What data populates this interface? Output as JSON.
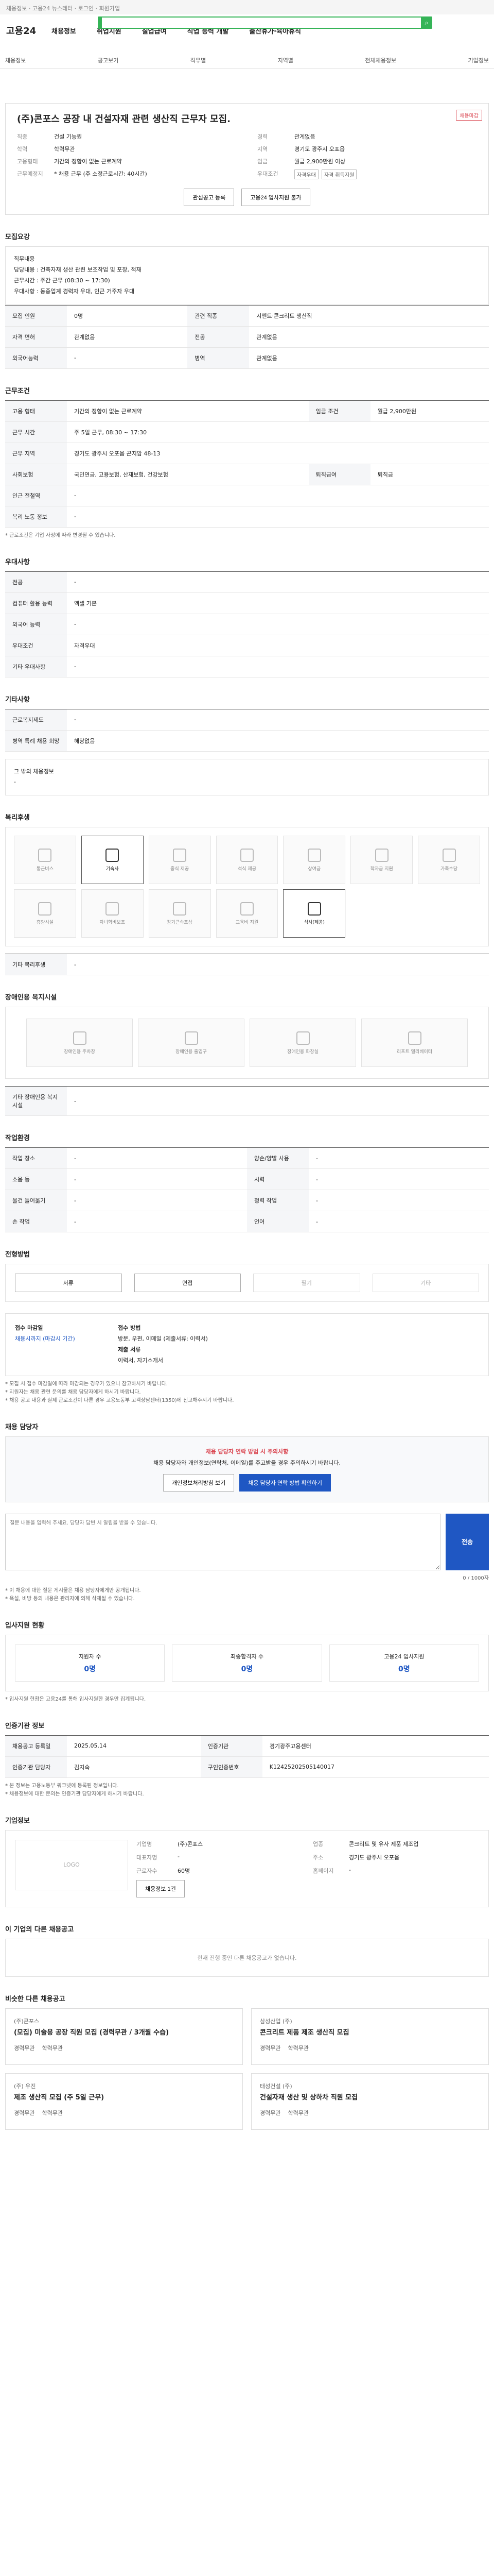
{
  "topbar": {
    "text": "채용정보 · 고용24 뉴스레터 · 로그인 · 회원가입"
  },
  "logo": {
    "brand": "고용24"
  },
  "gnb": [
    "채용정보",
    "취업지원",
    "실업급여",
    "직업 능력 개발",
    "출산휴가·육아휴직"
  ],
  "subnav": [
    "채용정보",
    "공고보기",
    "직무별",
    "지역별",
    "전체채용정보",
    "기업정보"
  ],
  "job": {
    "title": "(주)콘포스 공장 내 건설자재 관련 생산직 근무자 모집.",
    "badge": "채용마감",
    "left": [
      {
        "k": "직종",
        "v": "건설 기능원"
      },
      {
        "k": "학력",
        "v": "학력무관"
      },
      {
        "k": "고용형태",
        "v": "기간의 정함이 없는 근로계약"
      },
      {
        "k": "근무예정지",
        "v": "* 채용 근무 (주 소정근로시간: 40시간)"
      }
    ],
    "right": [
      {
        "k": "경력",
        "v": "관계없음"
      },
      {
        "k": "지역",
        "v": "경기도 광주시 오포읍"
      },
      {
        "k": "임금",
        "v": "월급 2,900만원 이상"
      },
      {
        "k": "우대조건",
        "v": "자격우대"
      }
    ],
    "tags": [
      "자격우대",
      "자격 취득지원"
    ],
    "actions": {
      "interest": "관심공고 등록",
      "apply": "고용24 입사지원 불가"
    }
  },
  "sections": {
    "jobDesc": {
      "title": "모집요강",
      "body": [
        "직무내용",
        "담당내용 : 건축자재 생산 관련 보조작업 및 포장, 적재",
        "근무시간 : 주간 근무 (08:30 ~ 17:30)",
        "우대사항 : 동종업계 경력자 우대, 인근 거주자 우대"
      ],
      "rows": [
        {
          "k": "모집 인원",
          "v": "0명"
        },
        {
          "k": "관련 직종",
          "v": "시멘트·콘크리트 생산직"
        },
        {
          "k": "자격 면허",
          "v": "관계없음"
        },
        {
          "k": "전공",
          "v": "관계없음"
        },
        {
          "k": "외국어능력",
          "v": "-"
        },
        {
          "k": "병역",
          "v": "관계없음"
        }
      ]
    },
    "workCond": {
      "title": "근무조건",
      "rows": [
        {
          "k": "고용 형태",
          "v": "기간의 정함이 없는 근로계약"
        },
        {
          "k": "임금 조건",
          "v": "월급 2,900만원"
        },
        {
          "k": "근무 시간",
          "v": "주 5일 근무, 08:30 ~ 17:30"
        },
        {
          "k": "근무 지역",
          "v": "경기도 광주시 오포읍 곤지암 48-13"
        },
        {
          "k": "사회보험",
          "v": "국민연금, 고용보험, 산재보험, 건강보험"
        },
        {
          "k": "퇴직급여",
          "v": "퇴직금"
        },
        {
          "k": "인근 전철역",
          "v": "-"
        },
        {
          "k": "복리 노동 정보",
          "v": "-"
        }
      ],
      "note": "* 근로조건은 기업 사정에 따라 변경될 수 있습니다."
    },
    "preference": {
      "title": "우대사항",
      "rows": [
        {
          "k": "전공",
          "v": "-"
        },
        {
          "k": "컴퓨터 활용 능력",
          "v": "엑셀 기본"
        },
        {
          "k": "외국어 능력",
          "v": "-"
        },
        {
          "k": "우대조건",
          "v": "자격우대"
        },
        {
          "k": "기타 우대사항",
          "v": "-"
        }
      ]
    },
    "etc": {
      "title": "기타사항",
      "rows": [
        {
          "k": "근로복지제도",
          "v": "-"
        },
        {
          "k": "병역 특례 채용 희망",
          "v": "해당없음"
        }
      ],
      "subTitle": "그 밖의 채용정보",
      "subValue": "-"
    },
    "welfare": {
      "title": "복리후생",
      "items": [
        "통근버스",
        "기숙사",
        "중식 제공",
        "석식 제공",
        "상여금",
        "학자금 지원",
        "가족수당",
        "휴양시설",
        "자녀학비보조",
        "장기근속포상",
        "교육비 지원",
        "식사(제공)"
      ],
      "active": [
        1,
        11
      ],
      "otherLabel": "기타 복리후생",
      "otherValue": "-"
    },
    "barrier": {
      "title": "장애인용 복지시설",
      "items": [
        "장애인용 주차장",
        "장애인용 출입구",
        "장애인용 화장실",
        "리프트 엘리베이터"
      ],
      "otherLabel": "기타 장애인용 복지시설",
      "otherValue": "-"
    },
    "environment": {
      "title": "작업환경",
      "rows": [
        {
          "k": "작업 장소",
          "v": "-"
        },
        {
          "k": "소음 등",
          "v": "-"
        },
        {
          "k": "물건 들어옮기",
          "v": "-"
        },
        {
          "k": "손 작업",
          "v": "-"
        }
      ],
      "rows2": [
        {
          "k": "양손/양발 사용",
          "v": "-"
        },
        {
          "k": "시력",
          "v": "-"
        },
        {
          "k": "청력 작업",
          "v": "-"
        },
        {
          "k": "언어",
          "v": "-"
        }
      ]
    },
    "process": {
      "title": "전형방법",
      "steps": [
        "서류",
        "면접",
        "필기",
        "기타"
      ],
      "active": [
        0,
        1
      ]
    },
    "apply": {
      "lbl1": "접수 마감일",
      "v1": "채용시까지 (마감시 기간)",
      "lbl2": "접수 방법",
      "v2": "방문, 우편, 이메일 (제출서류: 이력서)",
      "lbl3": "제출 서류",
      "v3": "이력서, 자기소개서",
      "notes": [
        "* 모집 시 접수 마감일에 따라 마감되는 경우가 있으니 참고하시기 바랍니다.",
        "* 지원자는 채용 관련 문의를 채용 담당자에게 하시기 바랍니다.",
        "* 채용 공고 내용과 실제 근로조건이 다른 경우 고용노동부 고객상담센터(1350)에 신고해주시기 바랍니다."
      ]
    },
    "qna": {
      "title": "채용 담당자",
      "warn": "채용 담당자 연락 방법 시 주의사항",
      "body": "채용 담당자와 개인정보(연락처, 이메일)를 주고받을 경우 주의하시기 바랍니다.",
      "btn1": "개인정보처리방침 보기",
      "btn2": "채용 담당자 연락 방법 확인하기",
      "formTitle": "채용 담당자에게 질문하기",
      "placeholder": "질문 내용을 입력해 주세요. 담당자 답변 시 알림을 받을 수 있습니다.",
      "send": "전송",
      "counter": "0 / 1000자",
      "notes": [
        "* 이 채용에 대한 질문 게시물은 채용 담당자에게만 공개됩니다.",
        "* 욕설, 비방 등의 내용은 관리자에 의해 삭제될 수 있습니다."
      ]
    },
    "stats": {
      "title": "입사지원 현황",
      "items": [
        {
          "label": "지원자 수",
          "value": "0명"
        },
        {
          "label": "최종합격자 수",
          "value": "0명"
        },
        {
          "label": "고용24 입사지원",
          "value": "0명"
        }
      ],
      "note": "* 입사지원 현황은 고용24를 통해 입사지원한 경우만 집계됩니다."
    },
    "info": {
      "title": "인증기관 정보",
      "rows": [
        {
          "k": "채용공고 등록일",
          "v": "2025.05.14"
        },
        {
          "k": "인증기관",
          "v": "경기광주고용센터"
        },
        {
          "k": "인증기관 담당자",
          "v": "김지숙"
        },
        {
          "k": "구인인증번호",
          "v": "K12425202505140017"
        }
      ],
      "notes": [
        "* 본 정보는 고용노동부 워크넷에 등록된 정보입니다.",
        "* 채용정보에 대한 문의는 인증기관 담당자에게 하시기 바랍니다."
      ]
    },
    "corp": {
      "title": "기업정보",
      "more": "더보기",
      "logo": "LOGO",
      "info": [
        {
          "k": "기업명",
          "v": "(주)콘포스"
        },
        {
          "k": "업종",
          "v": "콘크리트 및 유사 제품 제조업"
        },
        {
          "k": "대표자명",
          "v": "-"
        },
        {
          "k": "주소",
          "v": "경기도 광주시 오포읍"
        },
        {
          "k": "근로자수",
          "v": "60명"
        },
        {
          "k": "홈페이지",
          "v": "-"
        }
      ],
      "btn": "채용정보 1건"
    },
    "recent": {
      "title": "이 기업의 다른 채용공고",
      "empty": "현재 진행 중인 다른 채용공고가 없습니다."
    },
    "recommend": {
      "title": "비슷한 다른 채용공고",
      "cards": [
        {
          "co": "(주)콘포스",
          "title": "(모집) 미술용 공장 직원 모집 (경력무관 / 3개월 수습)",
          "a": "경력무관",
          "b": "학력무관"
        },
        {
          "co": "삼성산업 (주)",
          "title": "콘크리트 제품 제조 생산직 모집",
          "a": "경력무관",
          "b": "학력무관"
        },
        {
          "co": "(주) 우진",
          "title": "제조 생산직 모집 (주 5일 근무)",
          "a": "경력무관",
          "b": "학력무관"
        },
        {
          "co": "태성건설 (주)",
          "title": "건설자재 생산 및 상하차 직원 모집",
          "a": "경력무관",
          "b": "학력무관"
        }
      ]
    }
  }
}
